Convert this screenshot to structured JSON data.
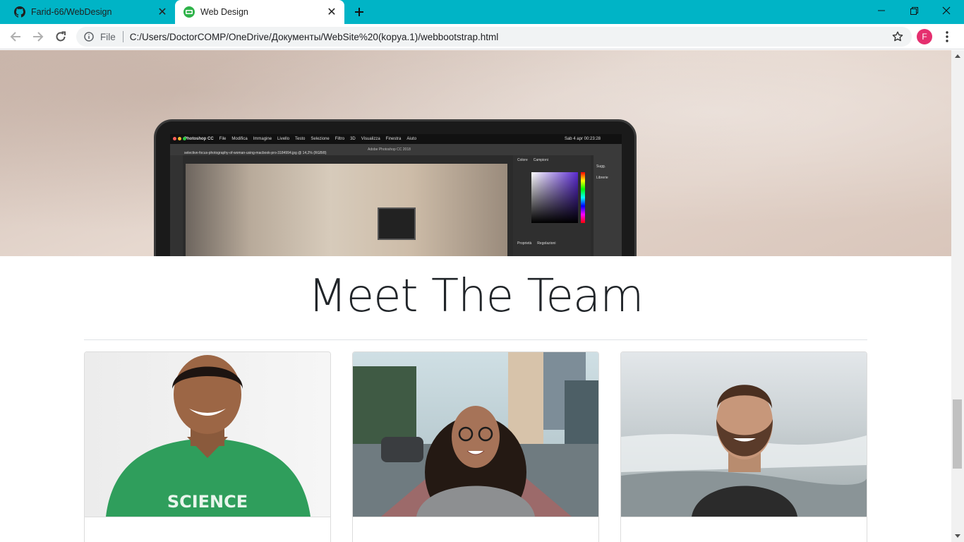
{
  "browser": {
    "tabs": [
      {
        "title": "Farid-66/WebDesign",
        "icon": "github-icon",
        "active": false
      },
      {
        "title": "Web Design",
        "icon": "site-favicon-icon",
        "active": true
      }
    ],
    "new_tab_label": "+",
    "address": {
      "scheme": "File",
      "url": "C:/Users/DoctorCOMP/OneDrive/Документы/WebSite%20(kopya.1)/webbootstrap.html"
    },
    "profile_initial": "F",
    "colors": {
      "tabstrip": "#00b4c6",
      "profile": "#e52f6f"
    }
  },
  "page": {
    "hero": {
      "app_title": "Adobe Photoshop CC 2018",
      "menu_items": [
        "Photoshop CC",
        "File",
        "Modifica",
        "Immagine",
        "Livello",
        "Testo",
        "Selezione",
        "Filtro",
        "3D",
        "Visualizza",
        "Finestra",
        "Aiuto"
      ],
      "status": "Sab 4 apr  00:23:28",
      "file_tab": "selective-focus-photography-of-woman-using-macbook-pro-3184994.jpg @ 14,2% (RGB/8)",
      "panel_tabs": [
        "Colore",
        "Campioni"
      ],
      "panel_side": [
        "Sugg.",
        "Librerie"
      ],
      "panel_bottom": [
        "Proprietà",
        "Regolazioni"
      ]
    },
    "team": {
      "title": "Meet The Team",
      "members": [
        {
          "photo": "man in green science t-shirt"
        },
        {
          "photo": "woman with glasses on city street"
        },
        {
          "photo": "bearded man by the sea"
        }
      ]
    }
  }
}
